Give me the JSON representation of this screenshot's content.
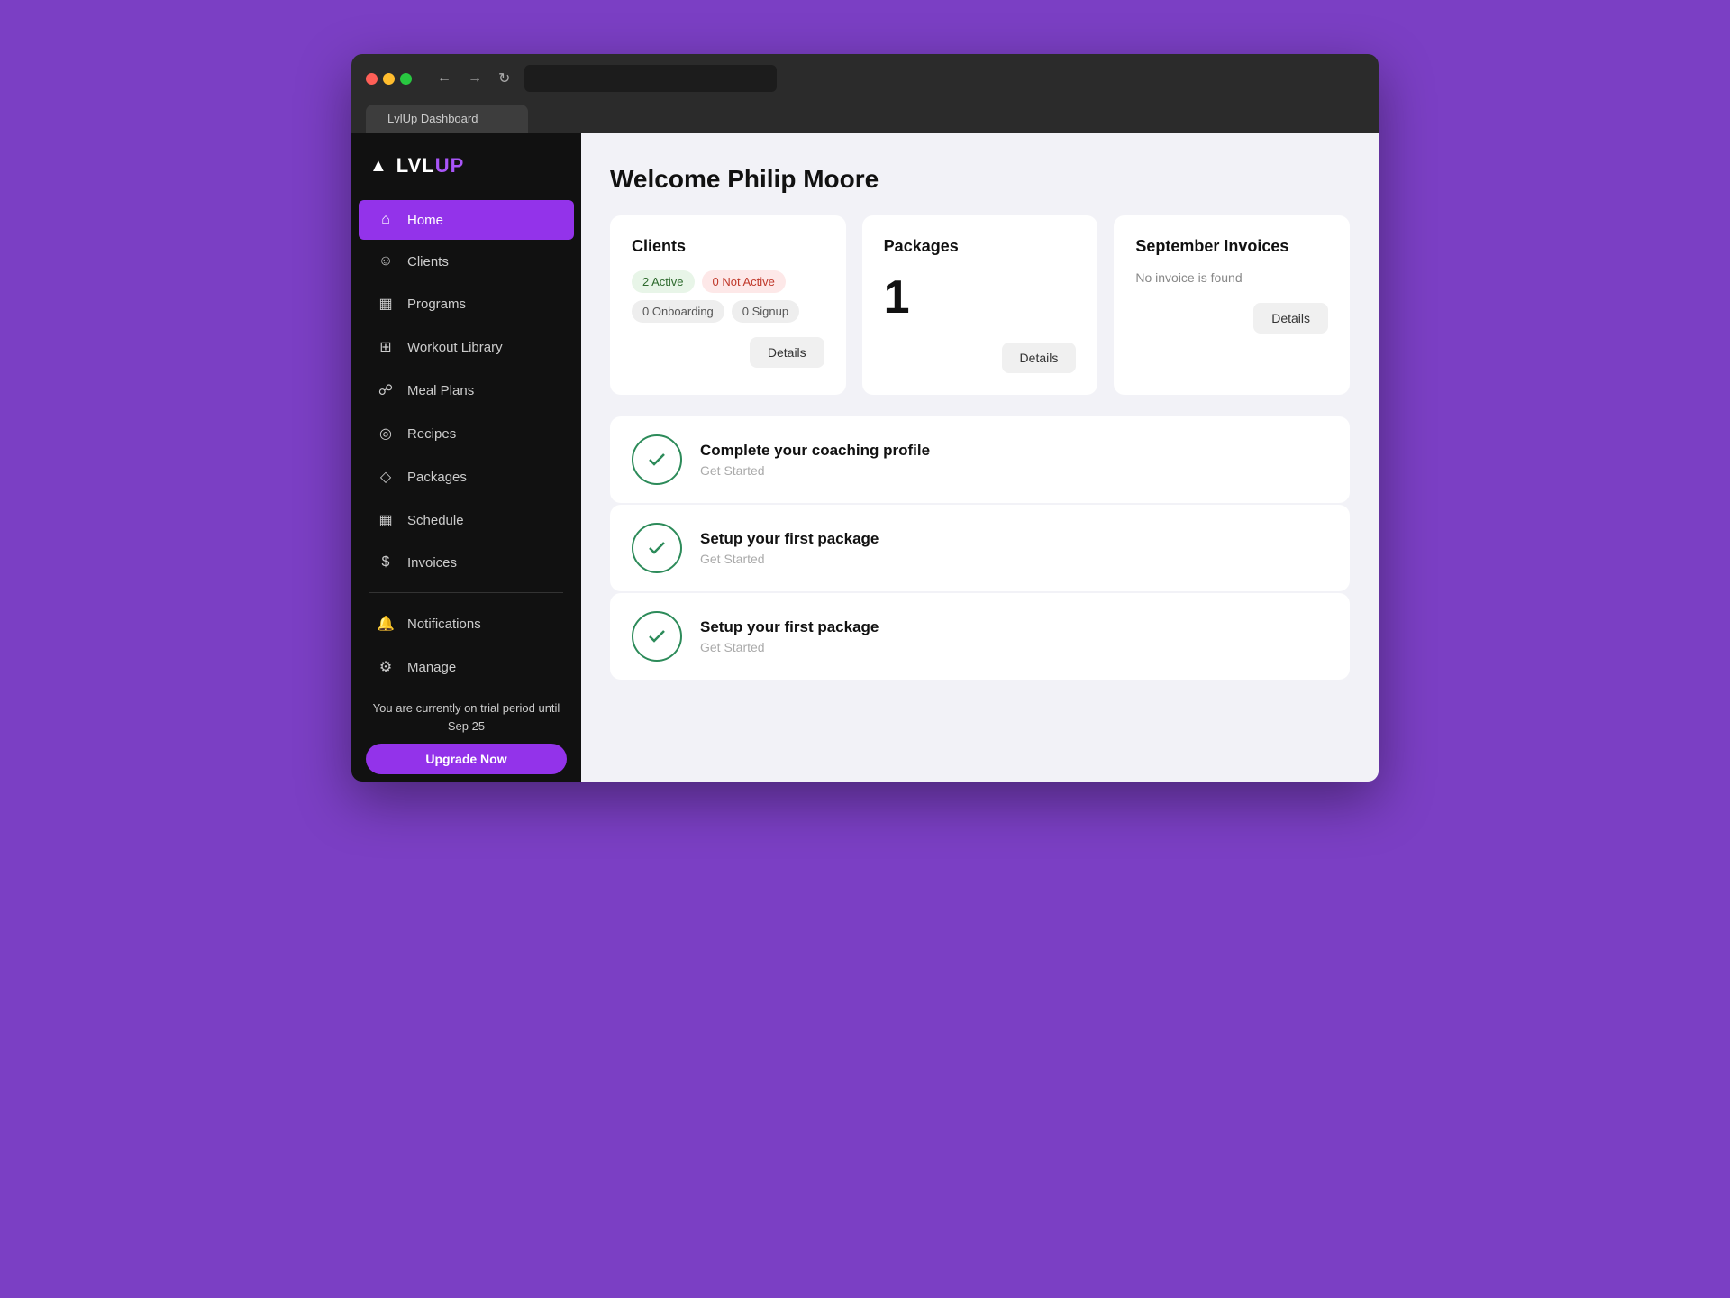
{
  "browser": {
    "tab_label": "LvlUp Dashboard",
    "url_placeholder": ""
  },
  "sidebar": {
    "logo": {
      "lvl": "LVL",
      "up": "UP"
    },
    "nav_items": [
      {
        "id": "home",
        "label": "Home",
        "icon": "🏠",
        "active": true
      },
      {
        "id": "clients",
        "label": "Clients",
        "icon": "👤",
        "active": false
      },
      {
        "id": "programs",
        "label": "Programs",
        "icon": "📅",
        "active": false
      },
      {
        "id": "workout-library",
        "label": "Workout Library",
        "icon": "🏋",
        "active": false
      },
      {
        "id": "meal-plans",
        "label": "Meal Plans",
        "icon": "📖",
        "active": false
      },
      {
        "id": "recipes",
        "label": "Recipes",
        "icon": "🍽",
        "active": false
      },
      {
        "id": "packages",
        "label": "Packages",
        "icon": "📦",
        "active": false
      },
      {
        "id": "schedule",
        "label": "Schedule",
        "icon": "📆",
        "active": false
      },
      {
        "id": "invoices",
        "label": "Invoices",
        "icon": "💲",
        "active": false
      }
    ],
    "bottom_items": [
      {
        "id": "notifications",
        "label": "Notifications",
        "icon": "🔔"
      },
      {
        "id": "manage",
        "label": "Manage",
        "icon": "⚙️"
      }
    ],
    "trial_text": "You are currently on trial period until Sep 25",
    "upgrade_label": "Upgrade Now"
  },
  "main": {
    "welcome_title": "Welcome Philip Moore",
    "cards": {
      "clients": {
        "title": "Clients",
        "badges": [
          {
            "label": "2 Active",
            "type": "green"
          },
          {
            "label": "0 Not Active",
            "type": "red"
          },
          {
            "label": "0 Onboarding",
            "type": "gray"
          },
          {
            "label": "0 Signup",
            "type": "gray"
          }
        ],
        "details_label": "Details"
      },
      "packages": {
        "title": "Packages",
        "count": "1",
        "details_label": "Details"
      },
      "invoices": {
        "title": "September Invoices",
        "empty_msg": "No invoice is found",
        "details_label": "Details"
      }
    },
    "checklist": [
      {
        "title": "Complete your coaching profile",
        "subtitle": "Get Started",
        "checked": true
      },
      {
        "title": "Setup your first package",
        "subtitle": "Get Started",
        "checked": true
      },
      {
        "title": "Setup your first package",
        "subtitle": "Get Started",
        "checked": true
      }
    ]
  }
}
